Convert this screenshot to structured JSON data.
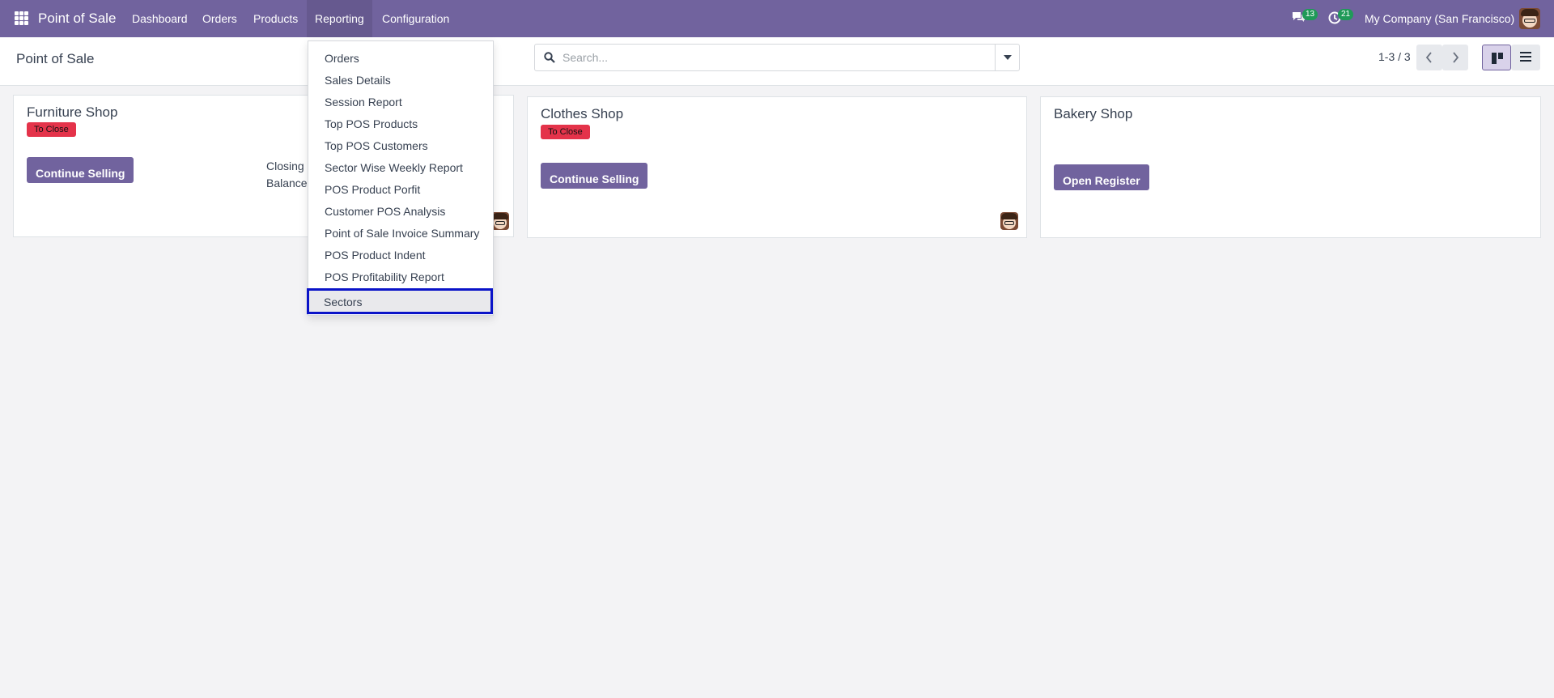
{
  "navbar": {
    "app_title": "Point of Sale",
    "menu": [
      "Dashboard",
      "Orders",
      "Products",
      "Reporting",
      "Configuration"
    ],
    "active_menu": "Reporting",
    "messages_count": "13",
    "activities_count": "21",
    "company": "My Company (San Francisco)"
  },
  "control_panel": {
    "breadcrumb": "Point of Sale",
    "search_placeholder": "Search...",
    "pager": "1-3 / 3"
  },
  "cards": [
    {
      "title": "Furniture Shop",
      "status": "To Close",
      "button": "Continue Selling",
      "meta": [
        "Closing",
        "Balance"
      ]
    },
    {
      "title": "Clothes Shop",
      "status": "To Close",
      "button": "Continue Selling"
    },
    {
      "title": "Bakery Shop",
      "button": "Open Register"
    }
  ],
  "reporting_menu": {
    "items": [
      "Orders",
      "Sales Details",
      "Session Report",
      "Top POS Products",
      "Top POS Customers",
      "Sector Wise Weekly Report",
      "POS Product Porfit",
      "Customer POS Analysis",
      "Point of Sale Invoice Summary",
      "POS Product Indent",
      "POS Profitability Report",
      "Sectors"
    ],
    "highlighted": "Sectors"
  },
  "colors": {
    "brand": "#71639e",
    "danger": "#e4334a",
    "success_badge": "#1f9a58",
    "highlight_border": "#0a13c8"
  },
  "icons": {
    "apps": "apps-grid-icon",
    "messages": "chat-bubbles-icon",
    "activities": "clock-activity-icon",
    "search": "search-icon",
    "kanban": "kanban-view-icon",
    "list": "list-view-icon"
  }
}
